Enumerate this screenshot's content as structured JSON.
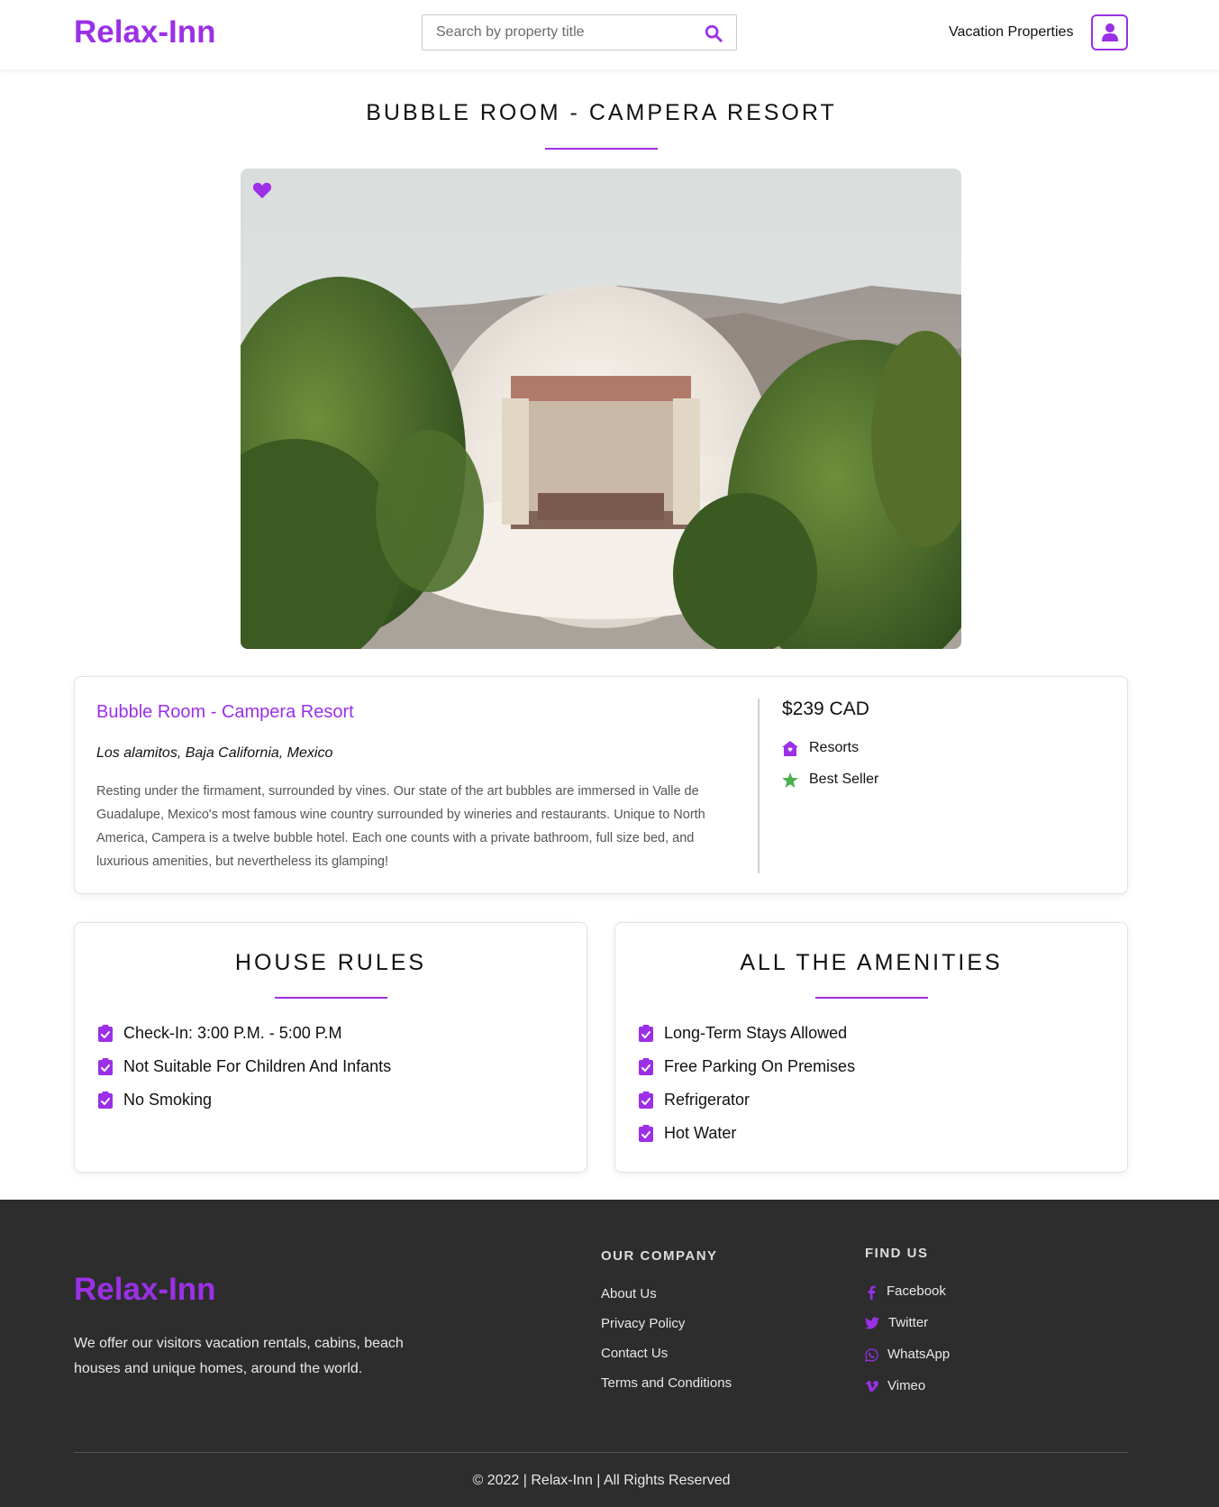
{
  "header": {
    "logo": "Relax-Inn",
    "search_placeholder": "Search by property title",
    "nav_link": "Vacation Properties"
  },
  "page": {
    "title": "BUBBLE ROOM - CAMPERA RESORT"
  },
  "property": {
    "name": "Bubble Room - Campera Resort",
    "location": "Los alamitos, Baja California, Mexico",
    "description": "Resting under the firmament, surrounded by vines. Our state of the art bubbles are immersed in Valle de Guadalupe, Mexico's most famous wine country surrounded by wineries and restaurants. Unique to North America, Campera is a twelve bubble hotel. Each one counts with a private bathroom, full size bed, and luxurious amenities, but nevertheless its glamping!",
    "price": "$239 CAD",
    "category": "Resorts",
    "badge": "Best Seller"
  },
  "house_rules": {
    "title": "HOUSE RULES",
    "items": [
      "Check-In: 3:00 P.M. - 5:00 P.M",
      "Not Suitable For Children And Infants",
      "No Smoking"
    ]
  },
  "amenities": {
    "title": "ALL THE AMENITIES",
    "items": [
      "Long-Term Stays Allowed",
      "Free Parking On Premises",
      "Refrigerator",
      "Hot Water"
    ]
  },
  "footer": {
    "logo": "Relax-Inn",
    "about": "We offer our visitors vacation rentals, cabins, beach houses and unique homes, around the world.",
    "company_heading": "OUR COMPANY",
    "company_links": [
      "About Us",
      "Privacy Policy",
      "Contact Us",
      "Terms and Conditions"
    ],
    "find_heading": "FIND US",
    "social_links": [
      "Facebook",
      "Twitter",
      "WhatsApp",
      "Vimeo"
    ],
    "copyright": "© 2022 | Relax-Inn | All Rights Reserved"
  },
  "colors": {
    "accent": "#9b30e6",
    "footer_bg": "#2d2d2d",
    "best_seller_star": "#4caf50"
  }
}
